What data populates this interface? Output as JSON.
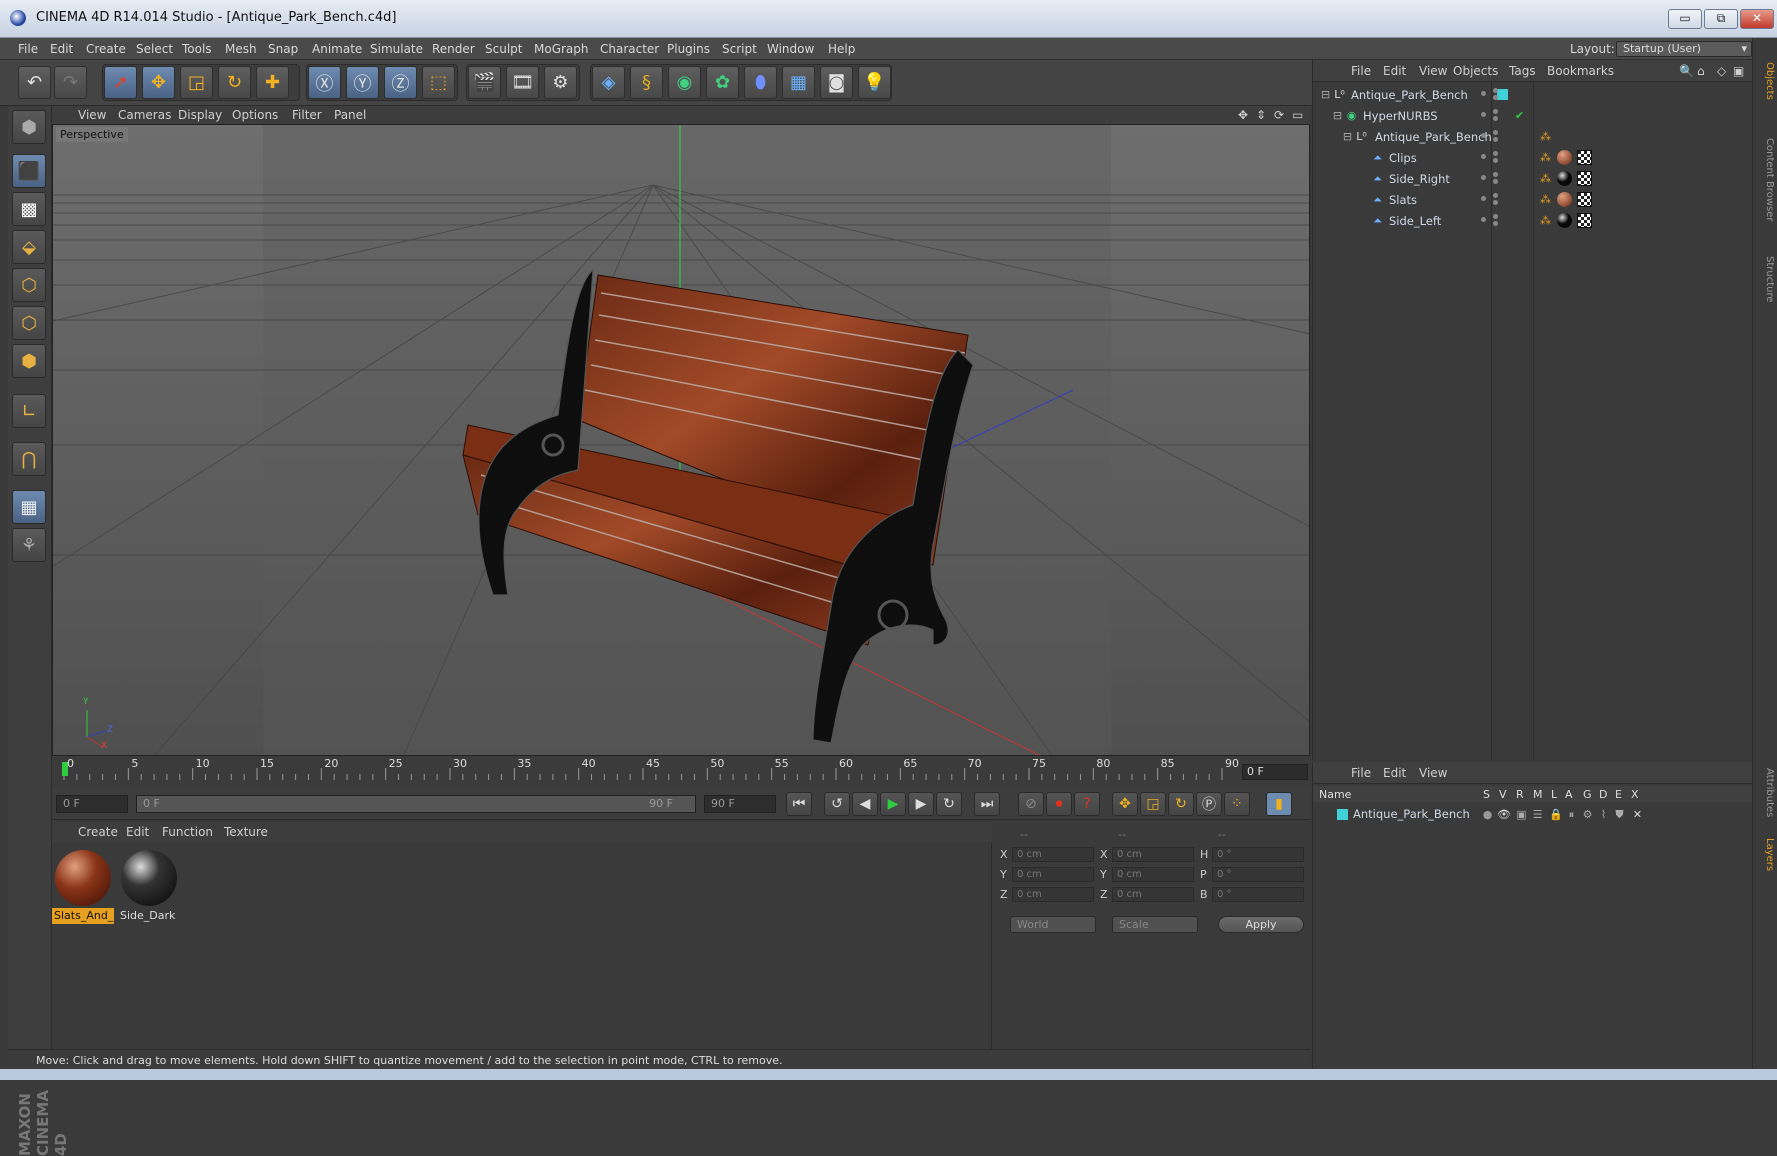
{
  "window": {
    "title": "CINEMA 4D R14.014 Studio - [Antique_Park_Bench.c4d]",
    "min": "▭",
    "max": "⧉",
    "close": "✕"
  },
  "menu": {
    "items": [
      "File",
      "Edit",
      "Create",
      "Select",
      "Tools",
      "Mesh",
      "Snap",
      "Animate",
      "Simulate",
      "Render",
      "Sculpt",
      "MoGraph",
      "Character",
      "Plugins",
      "Script",
      "Window",
      "Help"
    ],
    "layout_label": "Layout:",
    "layout_value": "Startup (User)"
  },
  "viewport": {
    "menu": [
      "View",
      "Cameras",
      "Display",
      "Options",
      "Filter",
      "Panel"
    ],
    "label": "Perspective",
    "axis_y": "Y",
    "axis_z": "Z",
    "axis_x": "X"
  },
  "timeline": {
    "ticks": [
      "0",
      "5",
      "10",
      "15",
      "20",
      "25",
      "30",
      "35",
      "40",
      "45",
      "50",
      "55",
      "60",
      "65",
      "70",
      "75",
      "80",
      "85",
      "90"
    ],
    "current_frame": "0 F"
  },
  "transport": {
    "start": "0 F",
    "range_start": "0 F",
    "range_end": "90 F",
    "end": "90 F"
  },
  "materials": {
    "menu": [
      "Create",
      "Edit",
      "Function",
      "Texture"
    ],
    "items": [
      {
        "name": "Slats_And_",
        "selected": true
      },
      {
        "name": "Side_Dark",
        "selected": false
      }
    ]
  },
  "coords": {
    "headers": [
      "--",
      "--",
      "--"
    ],
    "rows": [
      {
        "a": "X",
        "av": "0 cm",
        "b": "X",
        "bv": "0 cm",
        "c": "H",
        "cv": "0 °"
      },
      {
        "a": "Y",
        "av": "0 cm",
        "b": "Y",
        "bv": "0 cm",
        "c": "P",
        "cv": "0 °"
      },
      {
        "a": "Z",
        "av": "0 cm",
        "b": "Z",
        "bv": "0 cm",
        "c": "B",
        "cv": "0 °"
      }
    ],
    "space": "World",
    "mode": "Scale",
    "apply": "Apply"
  },
  "status": "Move: Click and drag to move elements. Hold down SHIFT to quantize movement / add to the selection in point mode, CTRL to remove.",
  "objects": {
    "menu": [
      "File",
      "Edit",
      "View",
      "Objects",
      "Tags",
      "Bookmarks"
    ],
    "tree": [
      {
        "name": "Antique_Park_Bench",
        "depth": 0
      },
      {
        "name": "HyperNURBS",
        "depth": 1
      },
      {
        "name": "Antique_Park_Bench",
        "depth": 2
      },
      {
        "name": "Clips",
        "depth": 3
      },
      {
        "name": "Side_Right",
        "depth": 3
      },
      {
        "name": "Slats",
        "depth": 3
      },
      {
        "name": "Side_Left",
        "depth": 3
      }
    ]
  },
  "layers": {
    "menu": [
      "File",
      "Edit",
      "View"
    ],
    "headers": [
      "Name",
      "S",
      "V",
      "R",
      "M",
      "L",
      "A",
      "G",
      "D",
      "E",
      "X"
    ],
    "rows": [
      "Antique_Park_Bench"
    ]
  },
  "right_tabs": [
    "Objects",
    "Content Browser",
    "Structure",
    "Attributes",
    "Layers"
  ],
  "brand": "MAXON CINEMA 4D",
  "colors": {
    "accent": "#e6a020",
    "layer_color": "#3fd0d8",
    "panel": "#3a3a3a"
  }
}
